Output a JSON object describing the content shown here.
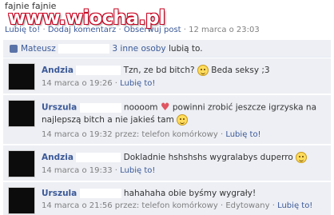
{
  "post": {
    "text": "fajnie fajnie",
    "meta_like": "Lubię to!",
    "meta_comment": "Dodaj komentarz",
    "meta_follow": "Obserwuj post",
    "meta_time": "12 marca o 23:03",
    "sep": "·"
  },
  "watermark": "www.wiocha.pl",
  "likes": {
    "name": "Mateusz",
    "others": "3 inne osoby",
    "suffix": "lubią to."
  },
  "comments": [
    {
      "author": "Andzia",
      "text": "Tzn, ze bd bitch?",
      "text_after": "Beda seksy ;3",
      "time": "14 marca o 19:26",
      "sep": "·",
      "like": "Lubię to!"
    },
    {
      "author": "Urszula",
      "text": "noooom",
      "text_after": "powinni zrobić jeszcze igrzyska na",
      "line2": "najlepszą bitch a nie jakieś tam",
      "time": "14 marca o 19:32 przez: telefon komórkowy",
      "sep": "·",
      "like": "Lubię to!"
    },
    {
      "author": "Andzia",
      "text": "Dokladnie hshshshs wygralabys duperro",
      "time": "14 marca o 19:33",
      "sep": "·",
      "like": "Lubię to!"
    },
    {
      "author": "Urszula",
      "text": "hahahaha obie byśmy wygrały!",
      "time": "14 marca o 21:56 przez: telefon komórkowy",
      "sep": "·",
      "edited": "Edytowany",
      "like": "Lubię to!"
    }
  ]
}
